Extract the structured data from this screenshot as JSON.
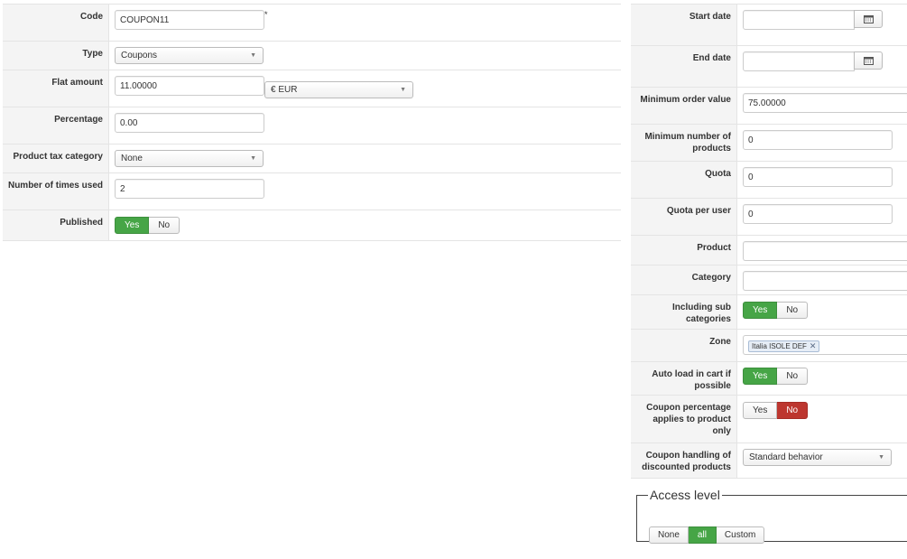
{
  "left": {
    "code": {
      "label": "Code",
      "value": "COUPON11",
      "required_mark": "*"
    },
    "type": {
      "label": "Type",
      "value": "Coupons"
    },
    "flat_amount": {
      "label": "Flat amount",
      "value": "11.00000",
      "currency": "€ EUR"
    },
    "percentage": {
      "label": "Percentage",
      "value": "0.00"
    },
    "tax_category": {
      "label": "Product tax category",
      "value": "None"
    },
    "times_used": {
      "label": "Number of times used",
      "value": "2"
    },
    "published": {
      "label": "Published",
      "yes": "Yes",
      "no": "No",
      "selected": "Yes"
    }
  },
  "right": {
    "start_date": {
      "label": "Start date",
      "value": ""
    },
    "end_date": {
      "label": "End date",
      "value": ""
    },
    "min_order": {
      "label": "Minimum order value",
      "value": "75.00000"
    },
    "min_products": {
      "label": "Minimum number of products",
      "value": "0"
    },
    "quota": {
      "label": "Quota",
      "value": "0"
    },
    "quota_user": {
      "label": "Quota per user",
      "value": "0"
    },
    "product": {
      "label": "Product",
      "value": ""
    },
    "category": {
      "label": "Category",
      "value": ""
    },
    "sub_categories": {
      "label": "Including sub categories",
      "yes": "Yes",
      "no": "No",
      "selected": "Yes"
    },
    "zone": {
      "label": "Zone",
      "tag": "Italia ISOLE DEF"
    },
    "auto_load": {
      "label": "Auto load in cart if possible",
      "yes": "Yes",
      "no": "No",
      "selected": "Yes"
    },
    "pct_product": {
      "label": "Coupon percentage applies to product only",
      "yes": "Yes",
      "no": "No",
      "selected": "No"
    },
    "discounted": {
      "label": "Coupon handling of discounted products",
      "value": "Standard behavior"
    }
  },
  "access": {
    "legend": "Access level",
    "options": [
      "None",
      "all",
      "Custom"
    ],
    "selected": "all"
  },
  "colors": {
    "green": "#46a546",
    "red": "#bd362f"
  },
  "icons": {
    "calendar": "calendar-icon",
    "dropdown": "chevron-down-icon",
    "remove": "close-icon"
  }
}
